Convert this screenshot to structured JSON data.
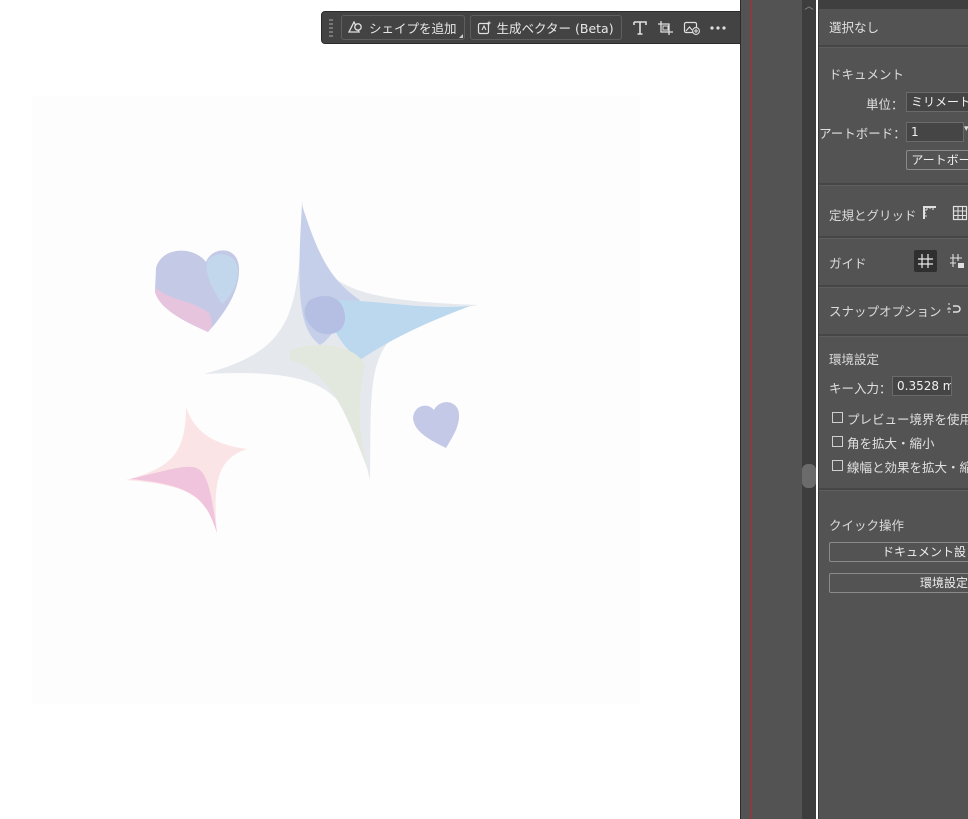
{
  "taskbar": {
    "add_shape_label": "シェイプを追加",
    "gen_vector_label": "生成ベクター (Beta)"
  },
  "panel": {
    "selection": "選択なし",
    "document_header": "ドキュメント",
    "unit_label": "単位：",
    "unit_value": "ミリメート",
    "artboard_label": "アートボード：",
    "artboard_value": "1",
    "artboard_button": "アートボー",
    "rulers_grids_header": "定規とグリッド",
    "guides_header": "ガイド",
    "snap_header": "スナップオプション",
    "prefs_header": "環境設定",
    "keyboard_increment_label": "キー入力：",
    "keyboard_increment_value": "0.3528 m",
    "checkbox_preview_bounds": "プレビュー境界を使用",
    "checkbox_scale_corners": "角を拡大・縮小",
    "checkbox_scale_strokes": "線幅と効果を拡大・縮",
    "quick_actions_header": "クイック操作",
    "document_setup_button": "ドキュメント設",
    "preferences_button": "環境設定"
  },
  "colors": {
    "panel_bg": "#535353",
    "toolbar_bg": "#434343",
    "accent_red": "#c0262d"
  }
}
